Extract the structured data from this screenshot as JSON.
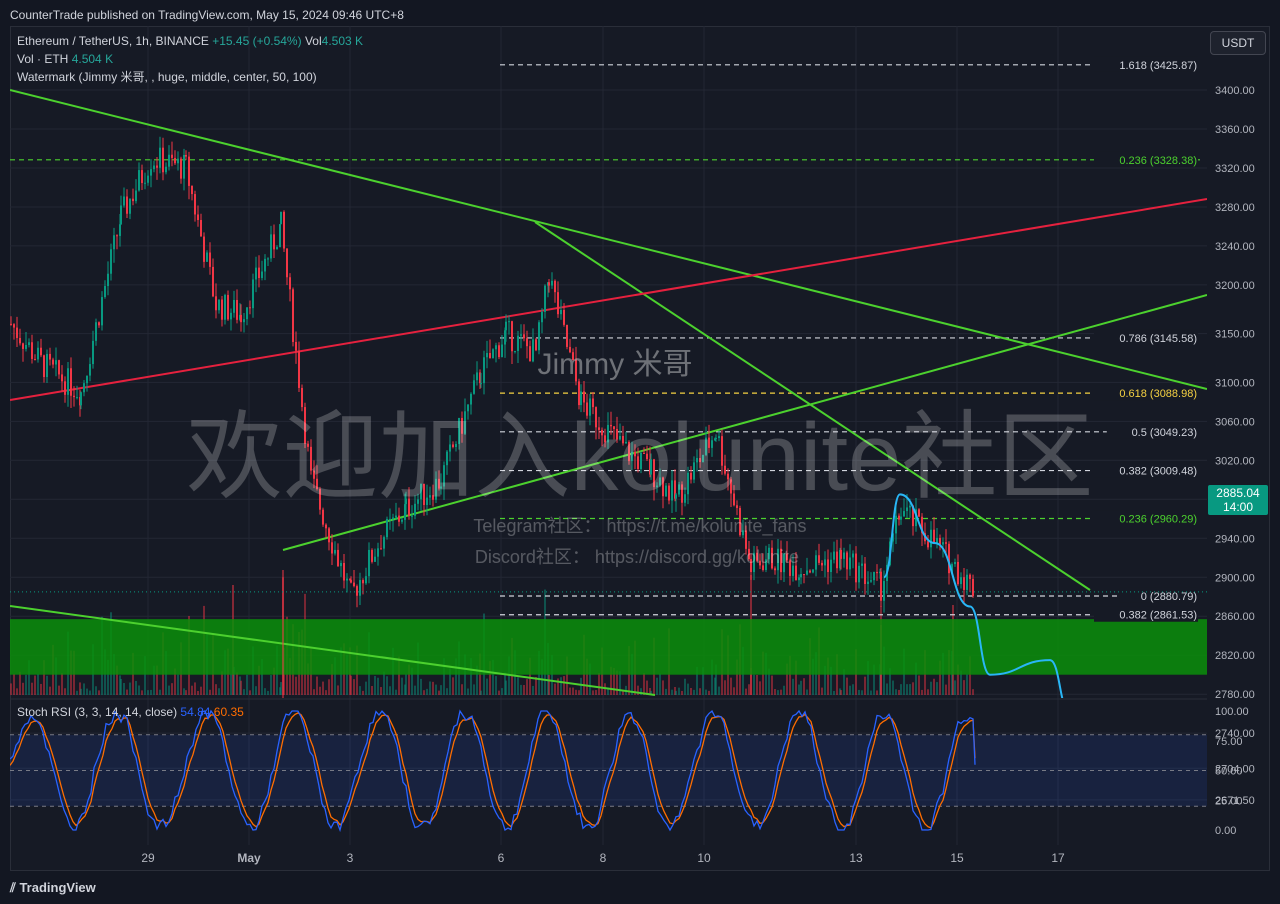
{
  "header": {
    "publish_info": "CounterTrade published on TradingView.com, May 15, 2024 09:46 UTC+8"
  },
  "legend": {
    "symbol": "Ethereum / TetherUS, 1h, BINANCE",
    "change": "+15.45 (+0.54%)",
    "vol_label": "Vol",
    "vol_value": "4.503 K",
    "vol_eth_label": "Vol · ETH",
    "vol_eth_value": "4.504 K",
    "watermark_label": "Watermark (Jimmy 米哥, , huge, middle, center, 50, 100)"
  },
  "currency_button": "USDT",
  "last_price": {
    "price": "2885.04",
    "countdown": "14:00"
  },
  "watermark": {
    "author": "Jimmy 米哥",
    "main": "欢迎加入kolunite社区",
    "telegram": "Telegram社区：  https://t.me/kolunite_fans",
    "discord": "Discord社区：  https://discord.gg/kolunite"
  },
  "rsi_legend": {
    "label": "Stoch RSI (3, 3, 14, 14, close)",
    "k": "54.84",
    "d": "60.35"
  },
  "footer": {
    "brand": "TradingView"
  },
  "colors": {
    "up": "#089981",
    "down": "#f23645",
    "trend_green": "#4cd12e",
    "trend_red": "#e5213e",
    "zone": "#0a8f0a",
    "projection": "#29b6f6",
    "rsi_k": "#2962ff",
    "rsi_d": "#ff6d00"
  },
  "chart_data": {
    "type": "candlestick",
    "symbol": "ETHUSDT",
    "interval": "1h",
    "price_axis_ticks": [
      "3400.00",
      "3360.00",
      "3320.00",
      "3280.00",
      "3240.00",
      "3200.00",
      "3150.00",
      "3100.00",
      "3060.00",
      "3020.00",
      "2980.00",
      "2940.00",
      "2900.00",
      "2860.00",
      "2820.00",
      "2780.00",
      "2740.00",
      "2704.00",
      "2671.50"
    ],
    "ylim": [
      2655,
      3440
    ],
    "time_axis_ticks": [
      "29",
      "May",
      "3",
      "6",
      "8",
      "10",
      "13",
      "15",
      "17"
    ],
    "fib_levels": [
      {
        "label": "1.618 (3425.87)",
        "price": 3425.87,
        "color": "#d1d4dc"
      },
      {
        "label": "0.236 (3328.38)",
        "price": 3328.38,
        "color": "#4cd12e"
      },
      {
        "label": "0.786 (3145.58)",
        "price": 3145.58,
        "color": "#d1d4dc"
      },
      {
        "label": "0.618 (3088.98)",
        "price": 3088.98,
        "color": "#f5d142"
      },
      {
        "label": "0.5 (3049.23)",
        "price": 3049.23,
        "color": "#d1d4dc"
      },
      {
        "label": "0.382 (3009.48)",
        "price": 3009.48,
        "color": "#d1d4dc"
      },
      {
        "label": "0.236 (2960.29)",
        "price": 2960.29,
        "color": "#4cd12e"
      },
      {
        "label": "0 (2880.79)",
        "price": 2880.79,
        "color": "#d1d4dc"
      },
      {
        "label": "0.382 (2861.53)",
        "price": 2861.53,
        "color": "#d1d4dc"
      }
    ],
    "support_zone": [
      2800,
      2857
    ],
    "price_path": [
      {
        "t": "Apr 25",
        "p": 3160
      },
      {
        "t": "Apr 26",
        "p": 3120
      },
      {
        "t": "Apr 27",
        "p": 3090
      },
      {
        "t": "Apr 28",
        "p": 3270
      },
      {
        "t": "Apr 28b",
        "p": 3330
      },
      {
        "t": "Apr 29",
        "p": 3320
      },
      {
        "t": "Apr 29b",
        "p": 3180
      },
      {
        "t": "Apr 30",
        "p": 3170
      },
      {
        "t": "Apr 30b",
        "p": 3260
      },
      {
        "t": "May 1",
        "p": 3000
      },
      {
        "t": "May 1b",
        "p": 2880
      },
      {
        "t": "May 2",
        "p": 2940
      },
      {
        "t": "May 3",
        "p": 2970
      },
      {
        "t": "May 3b",
        "p": 3000
      },
      {
        "t": "May 4",
        "p": 3110
      },
      {
        "t": "May 5",
        "p": 3150
      },
      {
        "t": "May 6",
        "p": 3130
      },
      {
        "t": "May 6b",
        "p": 3210
      },
      {
        "t": "May 7",
        "p": 3080
      },
      {
        "t": "May 8",
        "p": 3030
      },
      {
        "t": "May 8b",
        "p": 3010
      },
      {
        "t": "May 9",
        "p": 2980
      },
      {
        "t": "May 10",
        "p": 3050
      },
      {
        "t": "May 10b",
        "p": 2910
      },
      {
        "t": "May 11",
        "p": 2920
      },
      {
        "t": "May 12",
        "p": 2910
      },
      {
        "t": "May 13",
        "p": 2920
      },
      {
        "t": "May 13b",
        "p": 2890
      },
      {
        "t": "May 14",
        "p": 2970
      },
      {
        "t": "May 14b",
        "p": 2940
      },
      {
        "t": "May 15",
        "p": 2885
      }
    ],
    "projection_path": [
      {
        "t": "May 13b",
        "p": 2900
      },
      {
        "t": "May 14",
        "p": 2985
      },
      {
        "t": "May 14b",
        "p": 2935
      },
      {
        "t": "May 15",
        "p": 2870
      },
      {
        "t": "May 15b",
        "p": 2800
      },
      {
        "t": "May 16",
        "p": 2815
      },
      {
        "t": "May 16b",
        "p": 2760
      },
      {
        "t": "May 17",
        "p": 2660
      }
    ],
    "stoch_rsi": {
      "k_last": 54.84,
      "d_last": 60.35,
      "levels": [
        100,
        75,
        50,
        25,
        0
      ],
      "bands": [
        20,
        80
      ]
    }
  }
}
